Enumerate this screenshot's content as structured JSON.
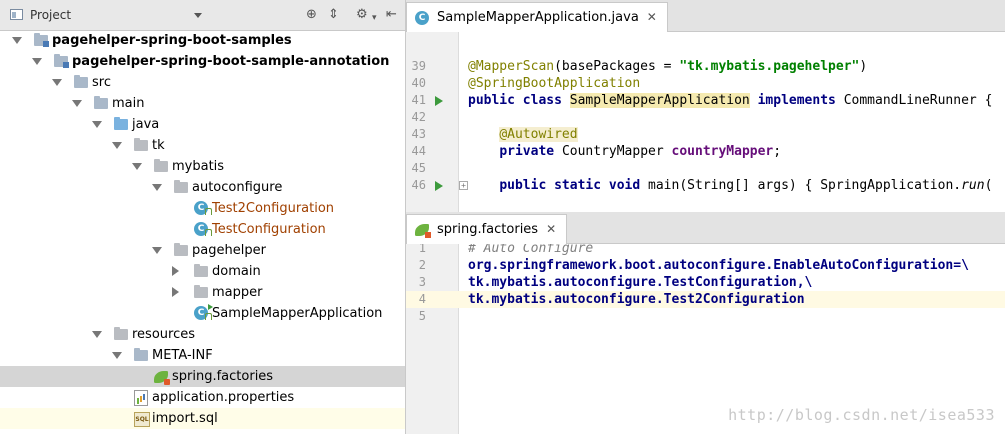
{
  "project_pane": {
    "title": "Project",
    "tree": [
      {
        "label": "pagehelper-spring-boot-samples",
        "depth": 0,
        "icon": "module-folder-icon",
        "expanded": true,
        "bold": true
      },
      {
        "label": "pagehelper-spring-boot-sample-annotation",
        "depth": 1,
        "icon": "module-folder-icon",
        "expanded": true,
        "bold": true
      },
      {
        "label": "src",
        "depth": 2,
        "icon": "folder-icon",
        "expanded": true
      },
      {
        "label": "main",
        "depth": 3,
        "icon": "folder-icon",
        "expanded": true
      },
      {
        "label": "java",
        "depth": 4,
        "icon": "source-folder-icon",
        "expanded": true
      },
      {
        "label": "tk",
        "depth": 5,
        "icon": "package-icon",
        "expanded": true
      },
      {
        "label": "mybatis",
        "depth": 6,
        "icon": "package-icon",
        "expanded": true
      },
      {
        "label": "autoconfigure",
        "depth": 7,
        "icon": "package-icon",
        "expanded": true
      },
      {
        "label": "Test2Configuration",
        "depth": 8,
        "icon": "class-icon",
        "orange": true
      },
      {
        "label": "TestConfiguration",
        "depth": 8,
        "icon": "class-icon",
        "orange": true
      },
      {
        "label": "pagehelper",
        "depth": 7,
        "icon": "package-icon",
        "expanded": true
      },
      {
        "label": "domain",
        "depth": 8,
        "icon": "package-icon",
        "expanded": false
      },
      {
        "label": "mapper",
        "depth": 8,
        "icon": "package-icon",
        "expanded": false
      },
      {
        "label": "SampleMapperApplication",
        "depth": 8,
        "icon": "runnable-class-icon"
      },
      {
        "label": "resources",
        "depth": 4,
        "icon": "resources-folder-icon",
        "expanded": true
      },
      {
        "label": "META-INF",
        "depth": 5,
        "icon": "folder-icon",
        "expanded": true
      },
      {
        "label": "spring.factories",
        "depth": 6,
        "icon": "spring-factories-icon",
        "selected": true
      },
      {
        "label": "application.properties",
        "depth": 5,
        "icon": "properties-file-icon"
      },
      {
        "label": "import.sql",
        "depth": 5,
        "icon": "sql-file-icon"
      }
    ]
  },
  "editor_top": {
    "tab_label": "SampleMapperApplication.java",
    "tab_icon": "C",
    "lines": [
      {
        "num": "39",
        "html": "<span class='ann'>@MapperScan</span>(basePackages = <span class='str'>\"tk.mybatis.pagehelper\"</span>)"
      },
      {
        "num": "40",
        "html": "<span class='ann'>@SpringBootApplication</span>"
      },
      {
        "num": "41",
        "html": "<span class='kw'>public class </span><span class='cls-hl'>SampleMapperApplication</span> <span class='kw'>implements </span>CommandLineRunner {",
        "run": true
      },
      {
        "num": "42",
        "html": ""
      },
      {
        "num": "43",
        "html": "    <span class='ann-hl'>@Autowired</span>"
      },
      {
        "num": "44",
        "html": "    <span class='kw'>private </span>CountryMapper <span class='field'>countryMapper</span>;"
      },
      {
        "num": "45",
        "html": ""
      },
      {
        "num": "46",
        "html": "    <span class='kw'>public static void </span>main(String[] args) { SpringApplication.<span class='ital'>run</span>(",
        "run": true,
        "fold": true
      }
    ]
  },
  "editor_bottom": {
    "tab_label": "spring.factories",
    "lines": [
      {
        "num": "1",
        "html": "<span class='cmt'># Auto Configure</span>"
      },
      {
        "num": "2",
        "html": "<span class='prop-key'>org.springframework.boot.autoconfigure.EnableAutoConfiguration=\\</span>"
      },
      {
        "num": "3",
        "html": "<span class='prop-key'>tk.mybatis.autoconfigure.TestConfiguration,\\</span>"
      },
      {
        "num": "4",
        "html": "<span class='prop-key'>tk.mybatis.autoconfigure.Test2Configuration</span>",
        "current": true
      },
      {
        "num": "5",
        "html": ""
      }
    ]
  },
  "watermark": "http://blog.csdn.net/isea533"
}
